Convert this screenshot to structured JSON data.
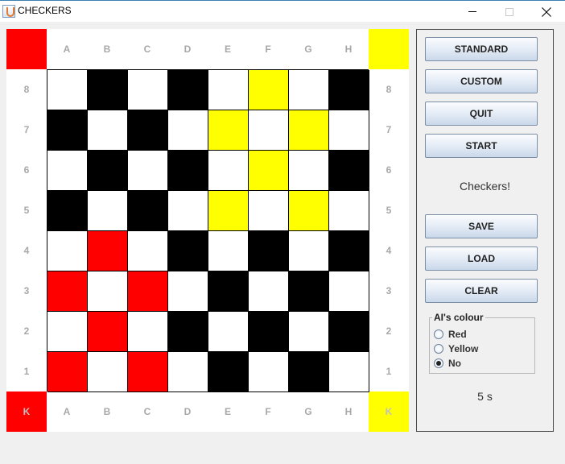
{
  "window": {
    "title": "CHECKERS",
    "icon": "java-cup-icon",
    "controls": [
      "minimize-icon",
      "maximize-icon",
      "close-icon"
    ]
  },
  "board": {
    "columns": [
      "A",
      "B",
      "C",
      "D",
      "E",
      "F",
      "G",
      "H"
    ],
    "rows": [
      "8",
      "7",
      "6",
      "5",
      "4",
      "3",
      "2",
      "1"
    ],
    "bottom_left_label": "K",
    "bottom_right_label": "K",
    "corner_colors": {
      "top_left": "#ff0000",
      "top_right": "#ffff00",
      "bottom_left": "#ff0000",
      "bottom_right": "#ffff00"
    },
    "colors": {
      "W": "#ffffff",
      "B": "#000000",
      "R": "#ff0000",
      "Y": "#ffff00"
    },
    "squares": [
      [
        "W",
        "B",
        "W",
        "B",
        "W",
        "Y",
        "W",
        "B"
      ],
      [
        "B",
        "W",
        "B",
        "W",
        "Y",
        "W",
        "Y",
        "W"
      ],
      [
        "W",
        "B",
        "W",
        "B",
        "W",
        "Y",
        "W",
        "B"
      ],
      [
        "B",
        "W",
        "B",
        "W",
        "Y",
        "W",
        "Y",
        "W"
      ],
      [
        "W",
        "R",
        "W",
        "B",
        "W",
        "B",
        "W",
        "B"
      ],
      [
        "R",
        "W",
        "R",
        "W",
        "B",
        "W",
        "B",
        "W"
      ],
      [
        "W",
        "R",
        "W",
        "B",
        "W",
        "B",
        "W",
        "B"
      ],
      [
        "R",
        "W",
        "R",
        "W",
        "B",
        "W",
        "B",
        "W"
      ]
    ]
  },
  "panel": {
    "standard_label": "STANDARD",
    "custom_label": "CUSTOM",
    "quit_label": "QUIT",
    "start_label": "START",
    "message": "Checkers!",
    "save_label": "SAVE",
    "load_label": "LOAD",
    "clear_label": "CLEAR",
    "ai_colour": {
      "legend": "AI's colour",
      "options": [
        "Red",
        "Yellow",
        "No"
      ],
      "selected": "No"
    },
    "timer": "5 s"
  }
}
